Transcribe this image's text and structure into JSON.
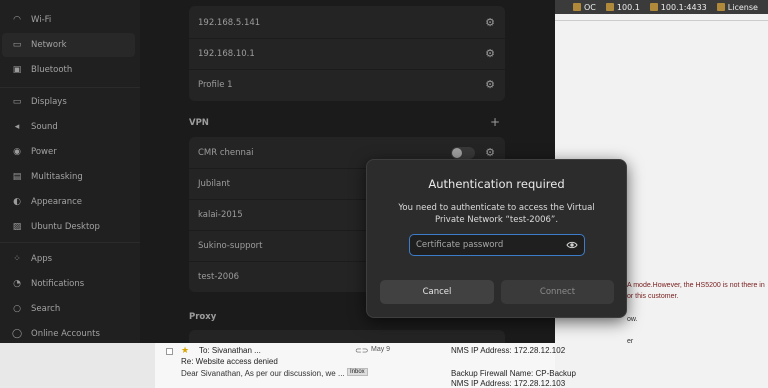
{
  "browser": {
    "tabs": [
      {
        "label": "OC"
      },
      {
        "label": "100.1"
      },
      {
        "label": "100.1:4433"
      },
      {
        "label": "License"
      }
    ],
    "fragments": {
      "a_mode": "A mode.However, the HS5200 is not there in",
      "customer": "or this customer.",
      "ow": "ow.",
      "er": "er"
    },
    "nms": {
      "line1": "NMS IP Address: 172.28.12.102",
      "line2": "Backup Firewall Name: CP-Backup",
      "line3": "NMS IP Address: 172.28.12.103"
    },
    "mail": {
      "from": "To: Sivanathan ...",
      "date": "May 9",
      "subject": "Re: Website access denied",
      "preview": "Dear Sivanathan, As per our discussion, we ...",
      "badge": "Inbox"
    }
  },
  "sidebar": {
    "items": [
      {
        "label": "Wi-Fi",
        "icon": "wifi-icon"
      },
      {
        "label": "Network",
        "icon": "network-icon"
      },
      {
        "label": "Bluetooth",
        "icon": "bluetooth-icon"
      },
      {
        "label": "Displays",
        "icon": "display-icon"
      },
      {
        "label": "Sound",
        "icon": "sound-icon"
      },
      {
        "label": "Power",
        "icon": "power-icon"
      },
      {
        "label": "Multitasking",
        "icon": "multitasking-icon"
      },
      {
        "label": "Appearance",
        "icon": "appearance-icon"
      },
      {
        "label": "Ubuntu Desktop",
        "icon": "ubuntu-desktop-icon"
      },
      {
        "label": "Apps",
        "icon": "apps-icon"
      },
      {
        "label": "Notifications",
        "icon": "notifications-icon"
      },
      {
        "label": "Search",
        "icon": "search-icon"
      },
      {
        "label": "Online Accounts",
        "icon": "online-accounts-icon"
      }
    ],
    "active": "Network"
  },
  "network": {
    "wired": [
      {
        "label": "192.168.5.141"
      },
      {
        "label": "192.168.10.1"
      },
      {
        "label": "Profile 1"
      }
    ],
    "vpn_title": "VPN",
    "vpn_add": "+",
    "vpn": [
      {
        "label": "CMR chennai",
        "toggle": false
      },
      {
        "label": "Jubilant"
      },
      {
        "label": "kalai-2015"
      },
      {
        "label": "Sukino-support"
      },
      {
        "label": "test-2006"
      }
    ],
    "proxy_title": "Proxy"
  },
  "dialog": {
    "title": "Authentication required",
    "message": "You need to authenticate to access the Virtual Private Network “test-2006”.",
    "password_placeholder": "Certificate password",
    "password_value": "",
    "cancel_label": "Cancel",
    "connect_label": "Connect",
    "connect_enabled": false,
    "accent_color": "#3d7cc9"
  }
}
